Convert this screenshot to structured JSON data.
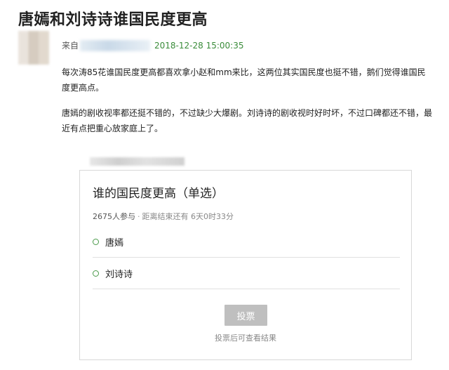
{
  "article": {
    "title": "唐嫣和刘诗诗谁国民度更高",
    "source_label": "来自",
    "date": "2018-12-28 15:00:35",
    "paragraphs": [
      "每次涛85花谁国民度更高都喜欢拿小赵和mm来比，这两位其实国民度也挺不错，鹅们觉得谁国民度更高点。",
      "唐嫣的剧收视率都还挺不错的，不过缺少大爆剧。刘诗诗的剧收视时好时坏，不过口碑都还不错，最近有点把重心放家庭上了。"
    ]
  },
  "poll": {
    "title": "谁的国民度更高（单选）",
    "participants": "2675人参与",
    "separator": "·",
    "deadline": "距离结束还有 6天0时33分",
    "options": [
      {
        "label": "唐嫣"
      },
      {
        "label": "刘诗诗"
      }
    ],
    "vote_button": "投票",
    "vote_hint": "投票后可查看结果"
  },
  "colors": {
    "accent": "#3a8c3a",
    "button_disabled": "#bfbfbf"
  }
}
